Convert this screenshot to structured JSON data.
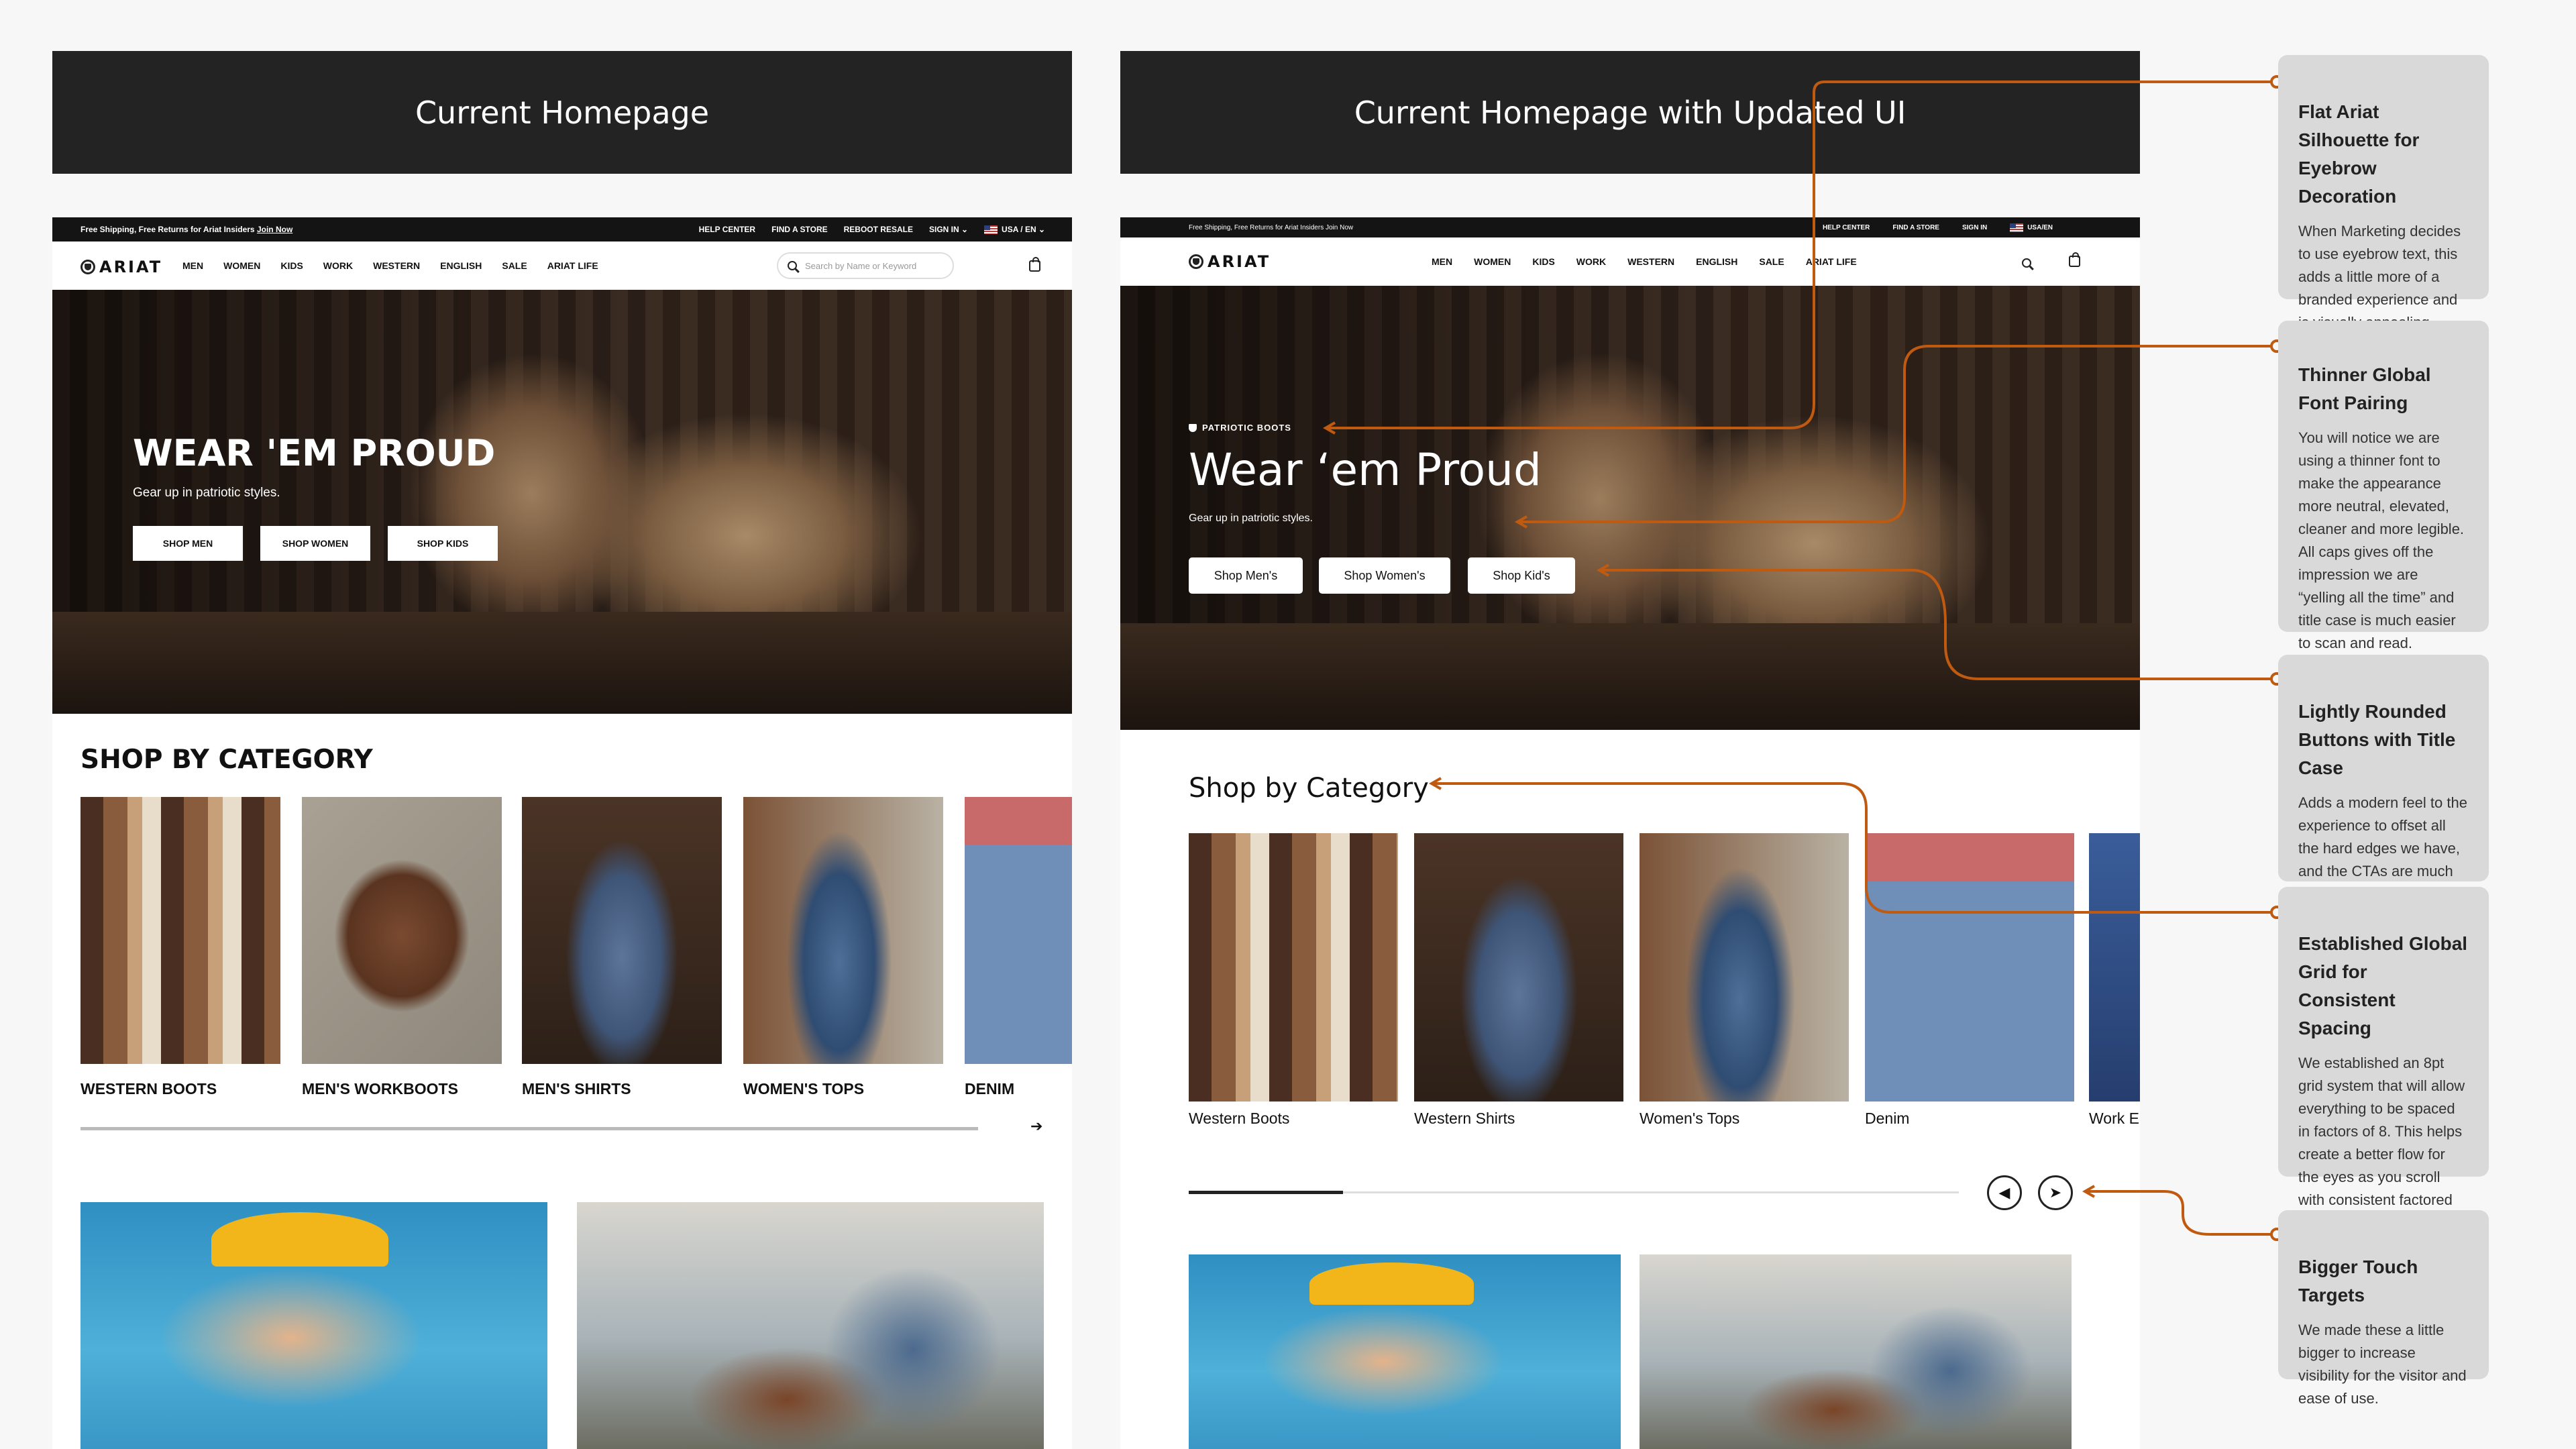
{
  "headers": {
    "left": "Current Homepage",
    "right": "Current Homepage with Updated UI"
  },
  "current": {
    "util_left": "Free Shipping, Free Returns for Ariat Insiders",
    "util_join": "Join Now",
    "util_links": [
      "HELP CENTER",
      "FIND A STORE",
      "REBOOT RESALE",
      "SIGN IN ⌄"
    ],
    "util_locale": "USA / EN ⌄",
    "logo": "ARIAT",
    "nav": [
      "MEN",
      "WOMEN",
      "KIDS",
      "WORK",
      "WESTERN",
      "ENGLISH",
      "SALE",
      "ARIAT LIFE"
    ],
    "search_placeholder": "Search by Name or Keyword",
    "hero_title": "WEAR 'EM PROUD",
    "hero_sub": "Gear up in patriotic styles.",
    "hero_buttons": [
      "SHOP MEN",
      "SHOP WOMEN",
      "SHOP KIDS"
    ],
    "section_title": "SHOP BY CATEGORY",
    "categories": [
      "WESTERN BOOTS",
      "MEN'S WORKBOOTS",
      "MEN'S SHIRTS",
      "WOMEN'S TOPS",
      "DENIM"
    ],
    "next_arrow": "➔"
  },
  "updated": {
    "util_left": "Free Shipping, Free Returns for Ariat Insiders Join Now",
    "util_links": [
      "HELP CENTER",
      "FIND A STORE",
      "SIGN IN"
    ],
    "util_locale": "USA/EN",
    "logo": "ARIAT",
    "nav": [
      "MEN",
      "WOMEN",
      "KIDS",
      "WORK",
      "WESTERN",
      "ENGLISH",
      "SALE",
      "ARIAT LIFE"
    ],
    "eyebrow": "PATRIOTIC BOOTS",
    "hero_title": "Wear ‘em Proud",
    "hero_sub": "Gear up in patriotic styles.",
    "hero_buttons": [
      "Shop Men's",
      "Shop Women's",
      "Shop Kid's"
    ],
    "section_title": "Shop by Category",
    "categories": [
      "Western Boots",
      "Western Shirts",
      "Women's Tops",
      "Denim",
      "Work E"
    ],
    "prev_arrow": "◀",
    "next_arrow": "➤"
  },
  "annotations": [
    {
      "title": "Flat Ariat Silhouette for Eyebrow Decoration",
      "body": "When Marketing decides to use eyebrow text, this adds a little more of a branded experience and is visually appealing."
    },
    {
      "title": "Thinner Global Font Pairing",
      "body": "You will notice we are using a thinner font to make the appearance more neutral, elevated, cleaner and more legible. All caps gives off the impression we are “yelling all the time” and title case is much easier to scan and read."
    },
    {
      "title": "Lightly Rounded Buttons with Title Case",
      "body": "Adds a modern feel to the experience to offset all the hard edges we have, and the CTAs are much more legible."
    },
    {
      "title": "Established Global Grid for Consistent Spacing",
      "body": "We established an 8pt grid system that will allow everything to be spaced in factors of 8. This helps create a better flow for the eyes as you scroll with consistent factored spacing rules."
    },
    {
      "title": "Bigger Touch Targets",
      "body": "We made these a little bigger to increase visibility for the visitor and ease of use."
    }
  ],
  "colors": {
    "background": "#f7f7f7",
    "header_bar": "#232323",
    "annotation_line": "#c05a10",
    "card": "#d9d9d9"
  }
}
